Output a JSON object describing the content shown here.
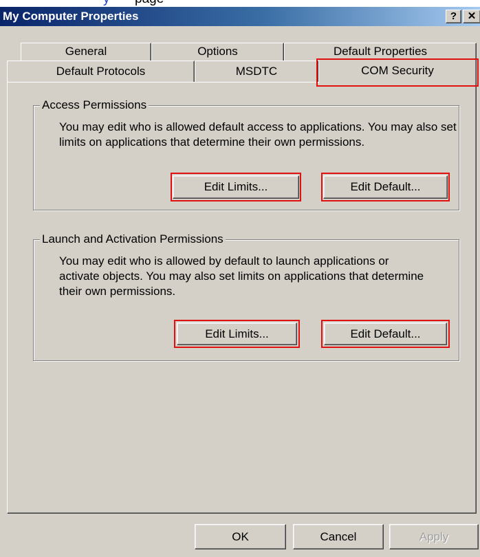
{
  "top_strip": {
    "link_fragment": "y",
    "text_fragment": "page"
  },
  "window": {
    "title": "My Computer Properties",
    "help_glyph": "?",
    "close_glyph": "✕"
  },
  "tabs": {
    "row1": [
      "General",
      "Options",
      "Default Properties"
    ],
    "row2": [
      "Default Protocols",
      "MSDTC",
      "COM Security"
    ],
    "active": "COM Security"
  },
  "access_permissions": {
    "legend": "Access Permissions",
    "description": "You may edit who is allowed default access to applications. You may also set limits on applications that determine their own permissions.",
    "edit_limits": "Edit Limits...",
    "edit_default": "Edit Default..."
  },
  "launch_permissions": {
    "legend": "Launch and Activation Permissions",
    "description": "You may edit who is allowed by default to launch applications or activate objects. You may also set limits on applications that determine their own permissions.",
    "edit_limits": "Edit Limits...",
    "edit_default": "Edit Default..."
  },
  "footer": {
    "ok": "OK",
    "cancel": "Cancel",
    "apply": "Apply"
  },
  "colors": {
    "highlight": "#e01010",
    "titlebar": "#0a246a",
    "face": "#d4d0c8"
  }
}
